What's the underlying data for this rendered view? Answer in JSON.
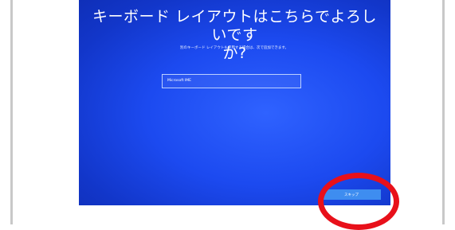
{
  "screen": {
    "title_line1": "キーボード レイアウトはこちらでよろしいです",
    "title_line2": "か?",
    "subtitle": "別のキーボード レイアウトも使用する場合は、次で追加できます。",
    "layout_list": {
      "items": [
        "Microsoft IME"
      ]
    },
    "skip_button_label": "スキップ"
  },
  "colors": {
    "background": "#1c4af0",
    "button": "#3e8df0",
    "annotation": "#e8101a"
  }
}
